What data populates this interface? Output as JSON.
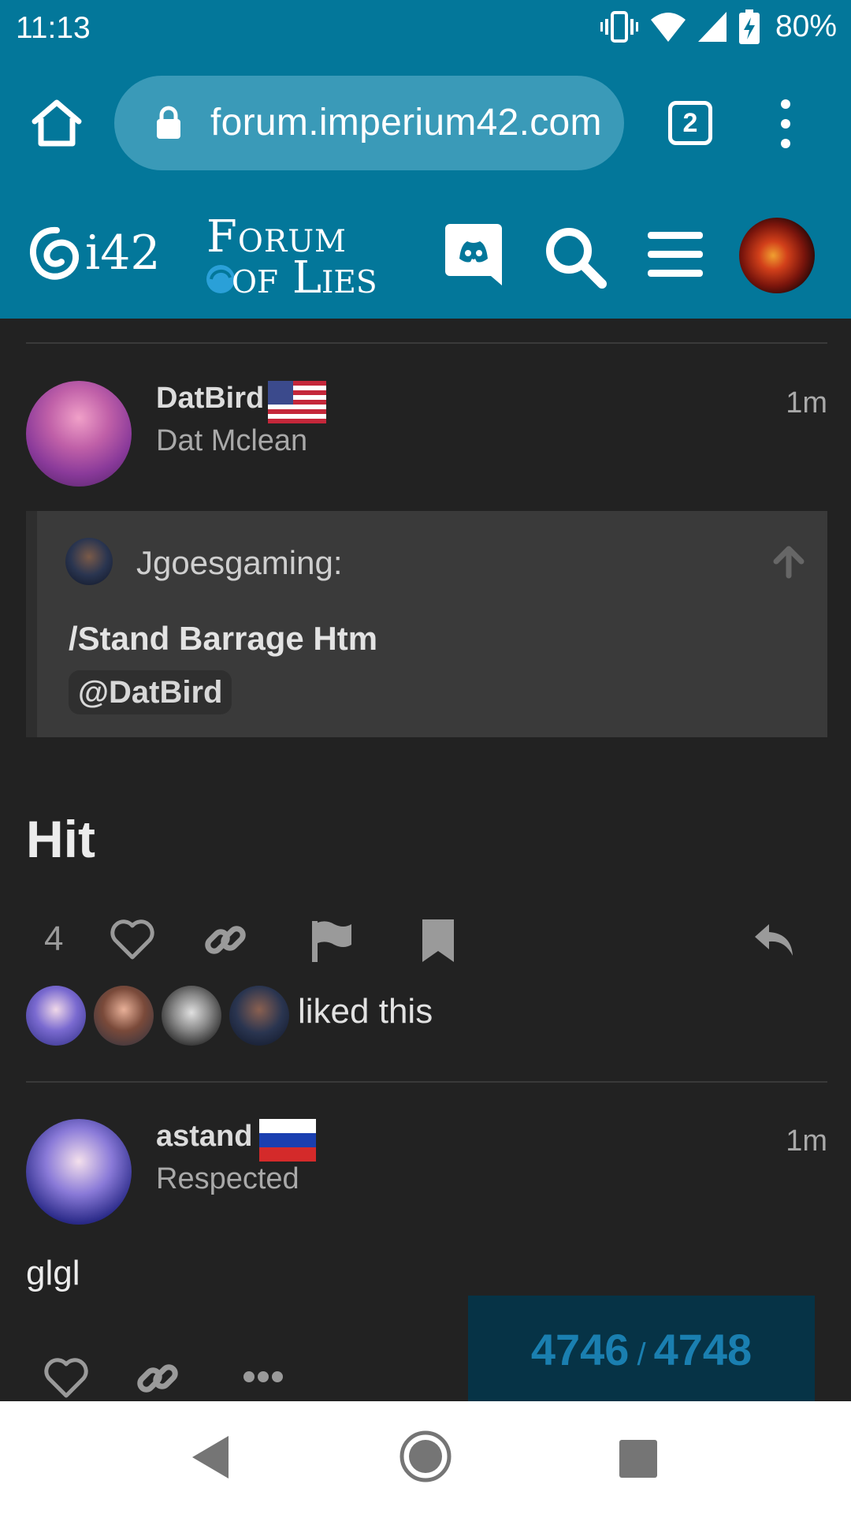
{
  "status": {
    "time": "11:13",
    "battery": "80%"
  },
  "browser": {
    "url": "forum.imperium42.com",
    "tab_count": "2"
  },
  "header": {
    "logo_i42": "i42",
    "logo_line1": "Forum",
    "logo_line2": "of Lies"
  },
  "post1": {
    "username": "DatBird",
    "title": "Dat Mclean",
    "time": "1m",
    "flag": "us-flag",
    "quote": {
      "user": "Jgoesgaming:",
      "text": "/Stand Barrage Htm",
      "mention": "@DatBird"
    },
    "body": "Hit",
    "like_count": "4",
    "liked_text": "liked this"
  },
  "post2": {
    "username": "astand",
    "title": "Respected",
    "time": "1m",
    "flag": "ru-flag",
    "body": "glgl"
  },
  "progress": {
    "current": "4746",
    "separator": "/",
    "total": "4748"
  },
  "colors": {
    "brand": "#03779a",
    "background": "#222222",
    "accent": "#1a7fb0"
  }
}
